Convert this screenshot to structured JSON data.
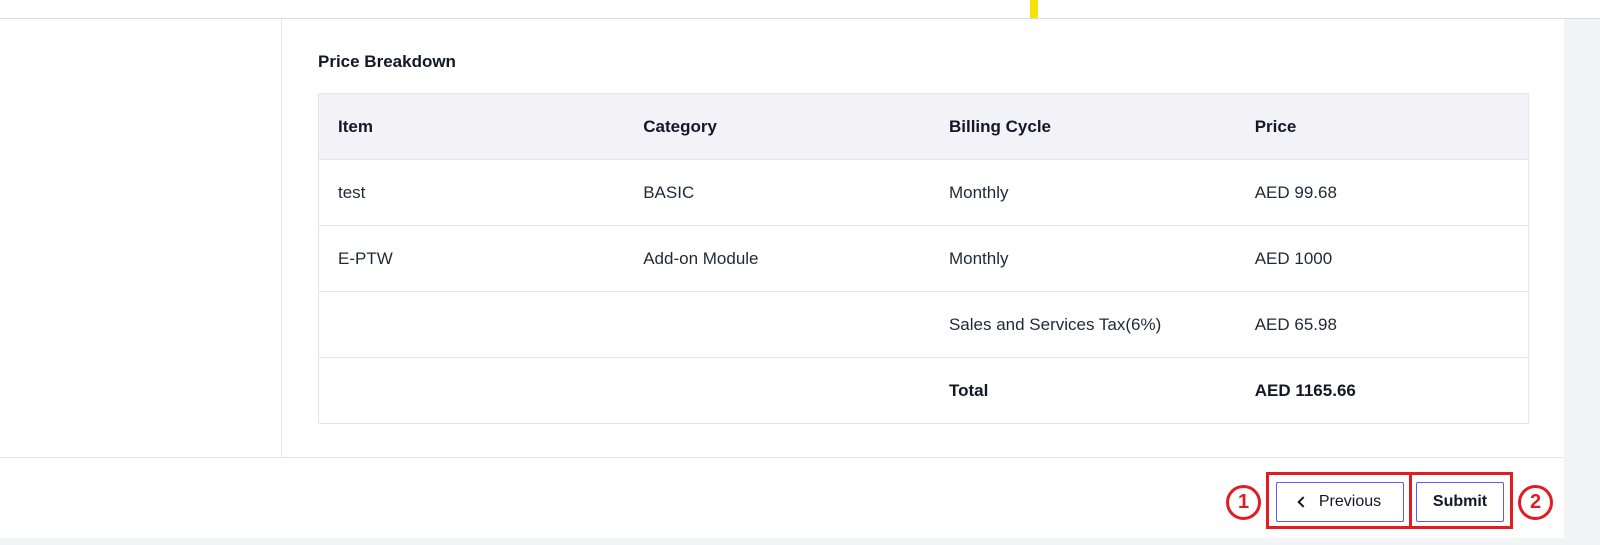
{
  "price_breakdown": {
    "title": "Price Breakdown",
    "columns": [
      "Item",
      "Category",
      "Billing Cycle",
      "Price"
    ],
    "rows": [
      {
        "item": "test",
        "category": "BASIC",
        "billing_cycle": "Monthly",
        "price": "AED 99.68"
      },
      {
        "item": "E-PTW",
        "category": "Add-on Module",
        "billing_cycle": "Monthly",
        "price": "AED 1000"
      }
    ],
    "tax": {
      "label": "Sales and Services Tax(6%)",
      "value": "AED 65.98"
    },
    "total": {
      "label": "Total",
      "value": "AED 1165.66"
    }
  },
  "footer": {
    "previous_label": "Previous",
    "submit_label": "Submit",
    "annotation_1": "1",
    "annotation_2": "2"
  },
  "colors": {
    "accent_border": "#5b5cf0",
    "annotation_red": "#e31b23",
    "table_header_bg": "#f3f3f7",
    "top_marker_yellow": "#f5e20a"
  },
  "icons": {
    "previous": "chevron-left-icon"
  }
}
